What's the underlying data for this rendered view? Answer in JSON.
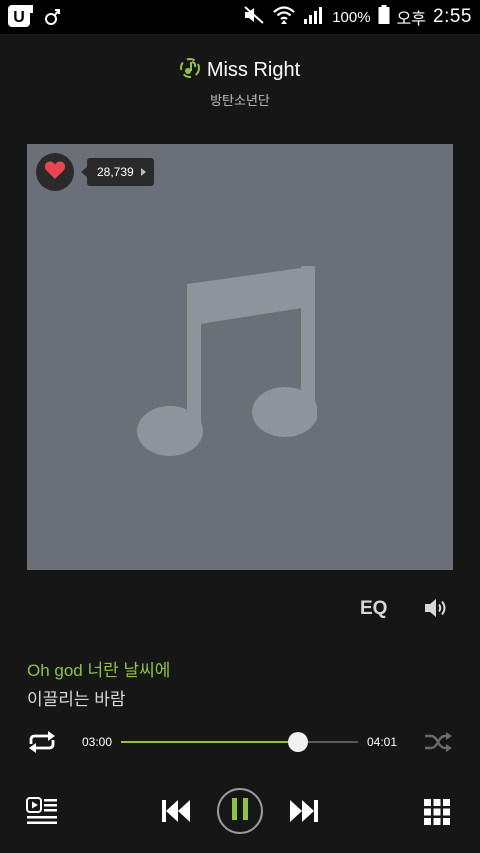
{
  "status_bar": {
    "carrier_logo": "U",
    "battery": "100%",
    "ampm": "오후",
    "time": "2:55",
    "icons": [
      "carrier-u-icon",
      "gender-icon",
      "mute-icon",
      "wifi-icon",
      "signal-icon",
      "battery-icon"
    ]
  },
  "now_playing": {
    "title": "Miss Right",
    "artist": "방탄소년단",
    "like_count": "28,739"
  },
  "controls": {
    "eq_label": "EQ"
  },
  "lyrics": {
    "current": "Oh god 너란 날씨에",
    "next": "이끌리는 바람"
  },
  "progress": {
    "current_time": "03:00",
    "total_time": "04:01",
    "fraction": 0.747
  },
  "colors": {
    "accent": "#8dc43f",
    "background": "#161616",
    "art_background": "#6b7078",
    "heart": "#e8454f"
  }
}
